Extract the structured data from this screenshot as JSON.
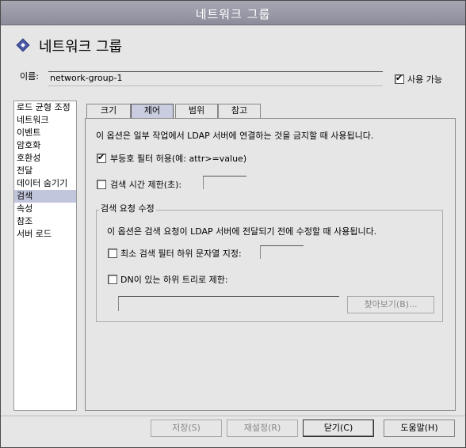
{
  "window": {
    "title": "네트워크 그룹"
  },
  "header": {
    "title": "네트워크 그룹",
    "icon": "diamond-icon"
  },
  "name": {
    "label": "이름:",
    "value": "network-group-1"
  },
  "enabled": {
    "label": "사용 가능",
    "checked": true
  },
  "sidebar": {
    "items": [
      {
        "label": "로드 균형 조정"
      },
      {
        "label": "네트워크"
      },
      {
        "label": "이벤트"
      },
      {
        "label": "암호화"
      },
      {
        "label": "호환성"
      },
      {
        "label": "전달"
      },
      {
        "label": "데이터 숨기기"
      },
      {
        "label": "검색",
        "selected": true
      },
      {
        "label": "속성"
      },
      {
        "label": "참조"
      },
      {
        "label": "서버 로드"
      }
    ]
  },
  "tabs": [
    {
      "label": "크기"
    },
    {
      "label": "제어",
      "active": true
    },
    {
      "label": "범위"
    },
    {
      "label": "참고"
    }
  ],
  "panel": {
    "description": "이 옵션은 일부 작업에서 LDAP 서버에 연결하는 것을 금지할 때 사용됩니다.",
    "allow_inequality": {
      "label": "부등호 필터 허용(예: attr>=value)",
      "checked": true
    },
    "time_limit": {
      "label": "검색 시간 제한(초):",
      "checked": false,
      "value": ""
    },
    "modify_group": {
      "title": "검색 요청 수정",
      "description": "이 옵션은 검색 요청이 LDAP 서버에 전달되기 전에 수정할 때 사용됩니다.",
      "min_substring": {
        "label": "최소 검색 필터 하위 문자열 지정:",
        "checked": false,
        "value": ""
      },
      "subtree": {
        "label": "DN이 있는 하위 트리로 제한:",
        "checked": false,
        "value": ""
      },
      "browse_button": "찾아보기(B)..."
    }
  },
  "footer": {
    "save": "저장(S)",
    "reset": "재설정(R)",
    "close": "닫기(C)",
    "help": "도움말(H)"
  }
}
